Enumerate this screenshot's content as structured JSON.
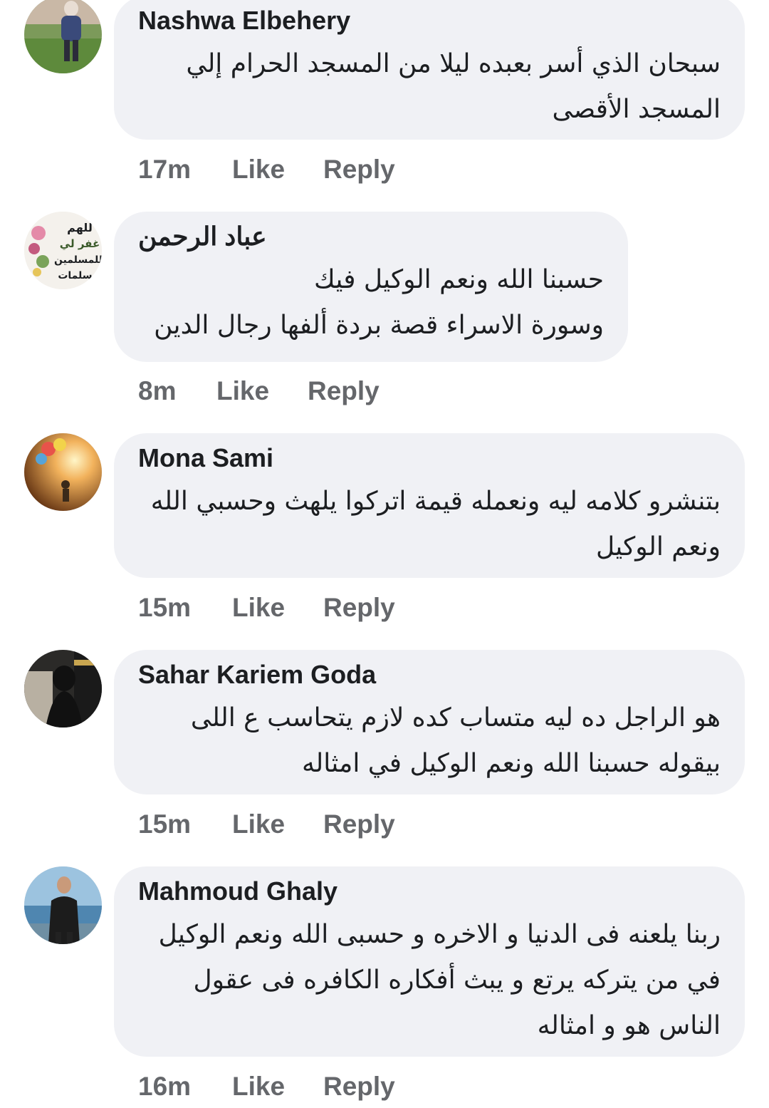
{
  "comments": [
    {
      "author": "Nashwa Elbehery",
      "text": "سبحان الذي أسر بعبده ليلا من المسجد الحرام إلي المسجد الأقصى",
      "time": "17m",
      "like": "Like",
      "reply": "Reply"
    },
    {
      "author": "عباد الرحمن",
      "text": "حسبنا الله ونعم الوكيل فيك\nوسورة الاسراء قصة بردة ألفها رجال الدين",
      "time": "8m",
      "like": "Like",
      "reply": "Reply",
      "avatar_text": "اللهم اغفر لي وللمسلمين والمسلمات"
    },
    {
      "author": "Mona Sami",
      "text": "بتنشرو كلامه ليه ونعمله قيمة اتركوا يلهث وحسبي الله ونعم الوكيل",
      "time": "15m",
      "like": "Like",
      "reply": "Reply"
    },
    {
      "author": "Sahar Kariem Goda",
      "text": "هو الراجل ده ليه متساب كده لازم يتحاسب ع اللى بيقوله حسبنا الله ونعم الوكيل في امثاله",
      "time": "15m",
      "like": "Like",
      "reply": "Reply"
    },
    {
      "author": "Mahmoud Ghaly",
      "text": "ربنا يلعنه فى الدنيا و الاخره و حسبى الله ونعم الوكيل في من يتركه يرتع و يبث أفكاره الكافره فى عقول الناس هو و امثاله",
      "time": "16m",
      "like": "Like",
      "reply": "Reply"
    }
  ]
}
